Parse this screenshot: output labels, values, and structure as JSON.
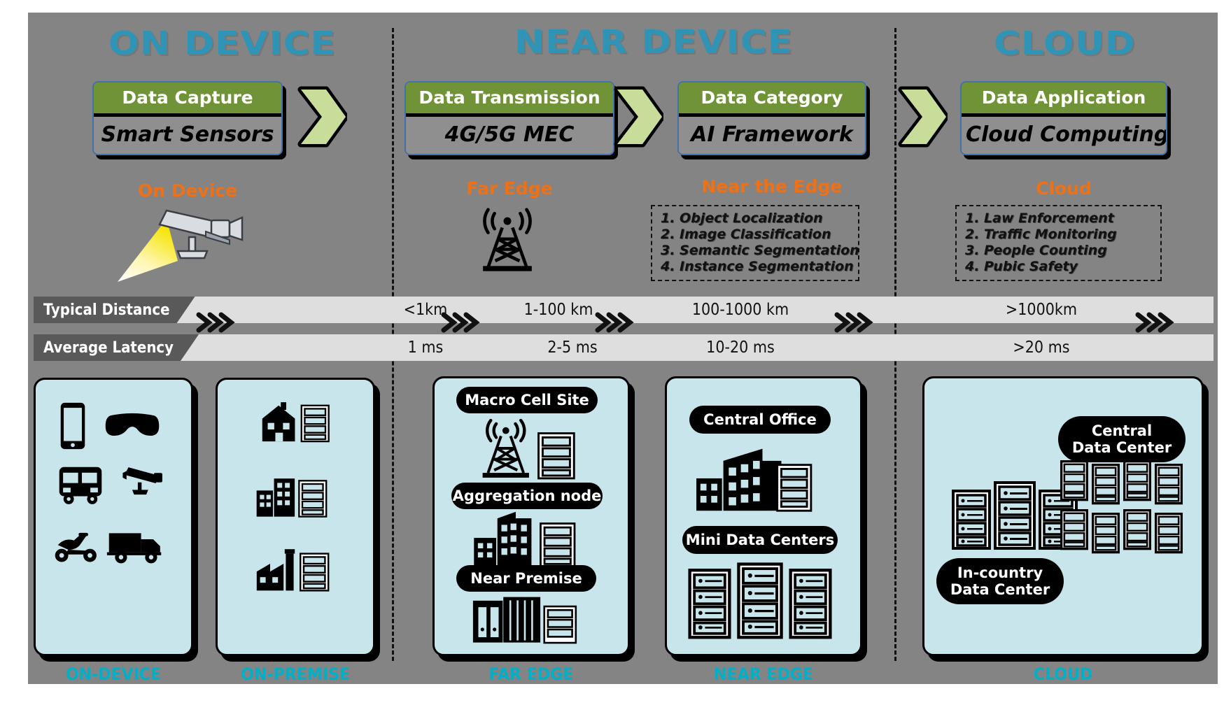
{
  "sections": [
    {
      "id": "on-device",
      "title": "ON DEVICE"
    },
    {
      "id": "near-device",
      "title": "NEAR DEVICE"
    },
    {
      "id": "cloud",
      "title": "CLOUD"
    }
  ],
  "stages": [
    {
      "id": "data-capture",
      "header": "Data Capture",
      "body": "Smart Sensors",
      "sublabel": "On Device"
    },
    {
      "id": "data-transmission",
      "header": "Data Transmission",
      "body": "4G/5G MEC",
      "sublabel": "Far Edge"
    },
    {
      "id": "data-category",
      "header": "Data Category",
      "body": "AI Framework",
      "sublabel": "Near the Edge"
    },
    {
      "id": "data-application",
      "header": "Data Application",
      "body": "Cloud Computing",
      "sublabel": "Cloud"
    }
  ],
  "task_lists": [
    {
      "id": "near-edge-tasks",
      "items": [
        "1. Object Localization",
        "2. Image Classification",
        "3. Semantic Segmentation",
        "4. Instance Segmentation"
      ]
    },
    {
      "id": "cloud-tasks",
      "items": [
        "1.  Law Enforcement",
        "2.  Traffic Monitoring",
        "3.  People Counting",
        "4.  Pubic Safety"
      ]
    }
  ],
  "metrics": [
    {
      "id": "typical-distance",
      "label": "Typical  Distance",
      "values": [
        "<1km",
        "1-100   km",
        "100-1000 km",
        ">1000km"
      ]
    },
    {
      "id": "average-latency",
      "label": "Average Latency",
      "values": [
        "1 ms",
        "2-5 ms",
        "10-20 ms",
        ">20 ms"
      ]
    }
  ],
  "panels": [
    {
      "id": "on-device",
      "caption": "ON-DEVICE",
      "pills": [],
      "icons": [
        "smartphone-icon",
        "vr-headset-icon",
        "bus-icon",
        "cctv-camera-icon",
        "scooter-icon",
        "truck-icon"
      ]
    },
    {
      "id": "on-premise",
      "caption": "ON-PREMISE",
      "pills": [],
      "icons": [
        "house-server-icon",
        "office-server-icon",
        "factory-server-icon"
      ]
    },
    {
      "id": "far-edge",
      "caption": "FAR EDGE",
      "pills": [
        "Macro Cell Site",
        "Aggregation node",
        "Near Premise"
      ],
      "icons": [
        "cell-tower-server-icon",
        "office-building-server-icon",
        "container-server-icon"
      ]
    },
    {
      "id": "near-edge",
      "caption": "NEAR EDGE",
      "pills": [
        "Central Office",
        "Mini Data Centers"
      ],
      "icons": [
        "office-buildings-server-icon",
        "server-racks-icon"
      ]
    },
    {
      "id": "cloud",
      "caption": "CLOUD",
      "pills": [
        "Central\nData Center",
        "In-country\nData Center"
      ],
      "icons": [
        "server-cluster-icon",
        "datacenter-grid-icon"
      ]
    }
  ],
  "colors": {
    "background": "#848484",
    "section_title": "#2f94b5",
    "sublabel": "#ee7116",
    "stage_header": "#6f9336",
    "chevron": "#c9dd9a",
    "panel": "#c7e5eb",
    "panel_caption": "#00b0c8",
    "metric_track": "#dedede",
    "metric_tag": "#595959"
  }
}
